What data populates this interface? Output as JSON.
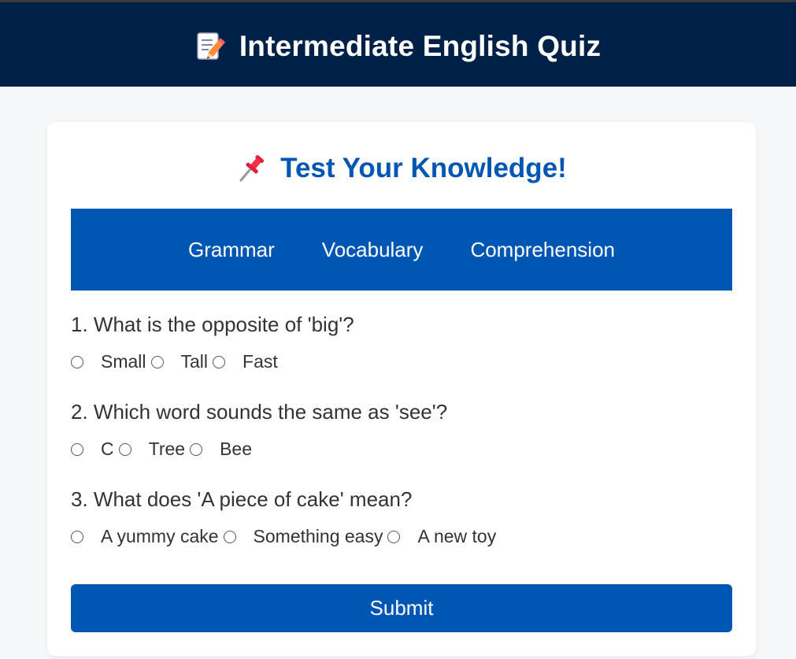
{
  "header": {
    "title": "Intermediate English Quiz",
    "icon": "memo-icon"
  },
  "card": {
    "title": "Test Your Knowledge!",
    "icon": "pushpin-icon"
  },
  "tabs": [
    {
      "label": "Grammar"
    },
    {
      "label": "Vocabulary"
    },
    {
      "label": "Comprehension"
    }
  ],
  "questions": [
    {
      "text": "1. What is the opposite of 'big'?",
      "options": [
        "Small",
        "Tall",
        "Fast"
      ]
    },
    {
      "text": "2. Which word sounds the same as 'see'?",
      "options": [
        "C",
        "Tree",
        "Bee"
      ]
    },
    {
      "text": "3. What does 'A piece of cake' mean?",
      "options": [
        "A yummy cake",
        "Something easy",
        "A new toy"
      ]
    }
  ],
  "submit_label": "Submit",
  "colors": {
    "header_bg": "#002147",
    "accent": "#0056b3",
    "page_bg": "#f6f7f9"
  }
}
